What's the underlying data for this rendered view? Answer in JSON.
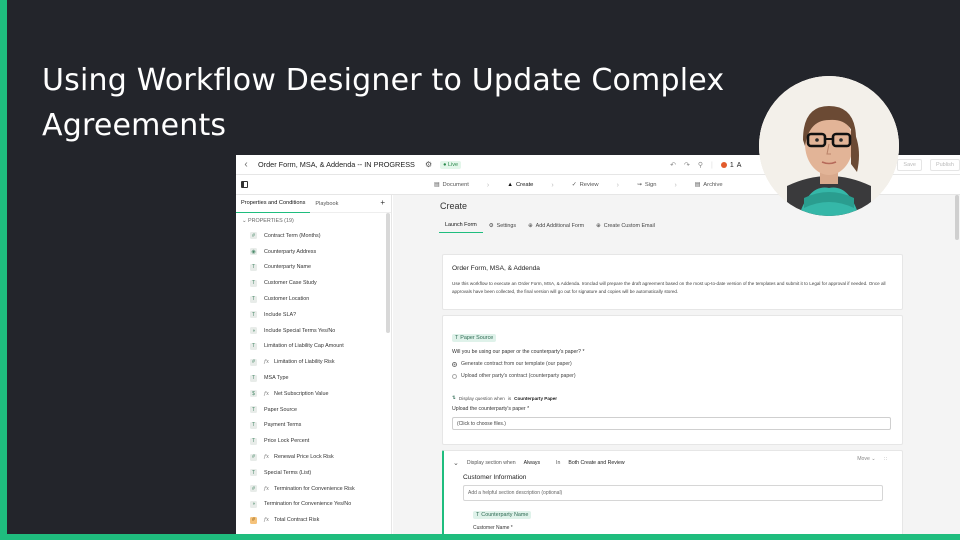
{
  "slide": {
    "title": "Using Workflow Designer to Update Complex Agreements",
    "accent_color": "#1fbd7e",
    "background_color": "#23252b"
  },
  "app": {
    "topbar": {
      "back_icon": "chevron-left-icon",
      "title": "Order Form, MSA, & Addenda -- IN PROGRESS",
      "live_badge": "Live",
      "alert_count": "1",
      "alert_label": "A",
      "save_label": "Save",
      "publish_label": "Publish"
    },
    "steps": [
      {
        "label": "Document",
        "icon": "document-icon"
      },
      {
        "label": "Create",
        "icon": "create-icon"
      },
      {
        "label": "Review",
        "icon": "check-icon"
      },
      {
        "label": "Sign",
        "icon": "sign-icon"
      },
      {
        "label": "Archive",
        "icon": "archive-icon"
      }
    ],
    "sidebar": {
      "tabs": [
        "Properties and Conditions",
        "Playbook"
      ],
      "add_icon": "+",
      "properties_header": "PROPERTIES (19)",
      "properties": [
        {
          "label": "Contract Term (Months)",
          "icon": "number",
          "fx": false
        },
        {
          "label": "Counterparty Address",
          "icon": "location",
          "fx": false
        },
        {
          "label": "Counterparty Name",
          "icon": "text",
          "fx": false
        },
        {
          "label": "Customer Case Study",
          "icon": "text",
          "fx": false
        },
        {
          "label": "Customer Location",
          "icon": "text",
          "fx": false
        },
        {
          "label": "Include SLA?",
          "icon": "text",
          "fx": false
        },
        {
          "label": "Include Special Terms Yes/No",
          "icon": "boolean",
          "fx": false
        },
        {
          "label": "Limitation of Liability Cap Amount",
          "icon": "text",
          "fx": false
        },
        {
          "label": "Limitation of Liability Risk",
          "icon": "number",
          "fx": true
        },
        {
          "label": "MSA Type",
          "icon": "text",
          "fx": false
        },
        {
          "label": "Net Subscription Value",
          "icon": "currency",
          "fx": true
        },
        {
          "label": "Paper Source",
          "icon": "text",
          "fx": false
        },
        {
          "label": "Payment Terms",
          "icon": "text",
          "fx": false
        },
        {
          "label": "Price Lock Percent",
          "icon": "text",
          "fx": false
        },
        {
          "label": "Renewal Price Lock Risk",
          "icon": "number",
          "fx": true
        },
        {
          "label": "Special Terms (List)",
          "icon": "text",
          "fx": false
        },
        {
          "label": "Termination for Convenience Risk",
          "icon": "number",
          "fx": true
        },
        {
          "label": "Termination for Convenience Yes/No",
          "icon": "boolean",
          "fx": false
        },
        {
          "label": "Total Contract Risk",
          "icon": "number-orange",
          "fx": true
        }
      ]
    },
    "main": {
      "title": "Create",
      "tabs": [
        "Launch Form",
        "Settings",
        "Add Additional Form",
        "Create Custom Email"
      ],
      "intro_card": {
        "title": "Order Form, MSA, & Addenda",
        "body": "Use this workflow to execute an Order Form, MSA, & Addenda. Ironclad will prepare the draft agreement based on the most up-to-date version of the templates and submit it to Legal for approval if needed. Once all approvals have been collected, the final version will go out for signature and copies will be automatically stored."
      },
      "paper_card": {
        "chip": "Paper Source",
        "question": "Will you be using our paper or the counterparty's paper? *",
        "options": [
          "Generate contract from our template (our paper)",
          "Upload other party's contract (counterparty paper)"
        ],
        "condition_prefix": "Display question when",
        "condition_is": "is",
        "condition_value": "Counterparty Paper",
        "upload_label": "Upload the counterparty's paper *",
        "upload_placeholder": "(Click to choose files.)"
      },
      "section_card": {
        "display_when_label": "Display section when",
        "display_when_value": "Always",
        "in_label": "In",
        "in_value": "Both Create and Review",
        "move_label": "Move",
        "section_title": "Customer Information",
        "description_placeholder": "Add a helpful section description (optional)",
        "chip": "Counterparty Name",
        "sub_label": "Customer Name *"
      }
    }
  }
}
